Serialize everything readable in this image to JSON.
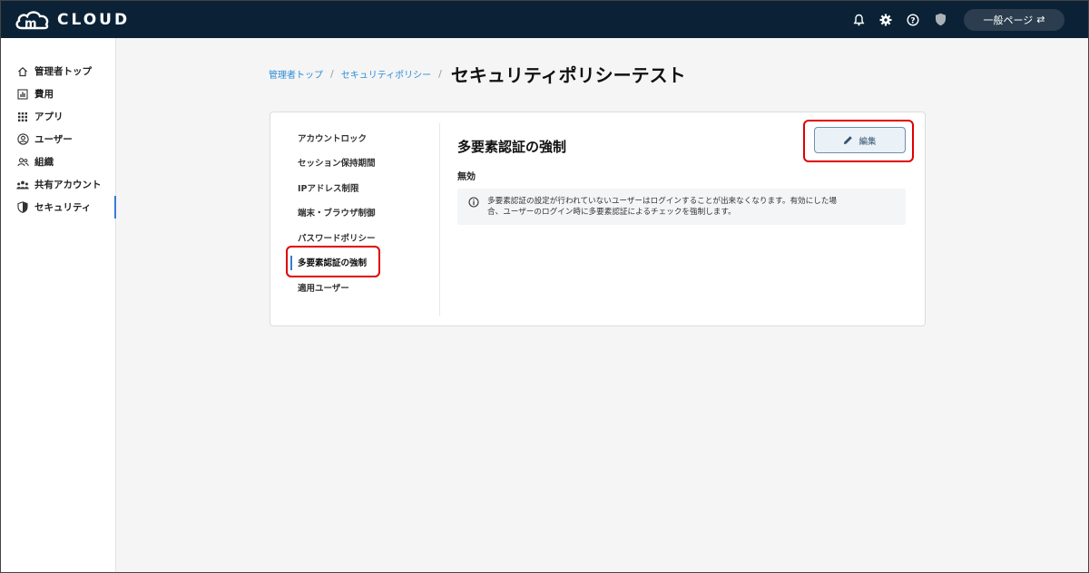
{
  "app": {
    "logo_text": "CLOUD"
  },
  "header": {
    "page_switch_label": "一般ページ"
  },
  "sidebar": {
    "items": [
      {
        "label": "管理者トップ",
        "icon": "home-icon"
      },
      {
        "label": "費用",
        "icon": "chart-icon"
      },
      {
        "label": "アプリ",
        "icon": "grid-icon"
      },
      {
        "label": "ユーザー",
        "icon": "user-circle-icon"
      },
      {
        "label": "組織",
        "icon": "group-icon"
      },
      {
        "label": "共有アカウント",
        "icon": "people-icon"
      },
      {
        "label": "セキュリティ",
        "icon": "shield-icon"
      }
    ],
    "active_index": 6
  },
  "breadcrumb": {
    "items": [
      "管理者トップ",
      "セキュリティポリシー"
    ],
    "current": "セキュリティポリシーテスト"
  },
  "submenu": {
    "items": [
      "アカウントロック",
      "セッション保持期間",
      "IPアドレス制限",
      "端末・ブラウザ制御",
      "パスワードポリシー",
      "多要素認証の強制",
      "適用ユーザー"
    ],
    "active_index": 5
  },
  "content": {
    "title": "多要素認証の強制",
    "edit_label": "編集",
    "status": "無効",
    "info_line1": "多要素認証の設定が行われていないユーザーはログインすることが出来なくなります。有効にした場",
    "info_line2": "合、ユーザーのログイン時に多要素認証によるチェックを強制します。"
  },
  "colors": {
    "topbar": "#0b2236",
    "accent": "#3a7bd5",
    "link": "#2a8bd6",
    "highlight": "#e00000"
  }
}
